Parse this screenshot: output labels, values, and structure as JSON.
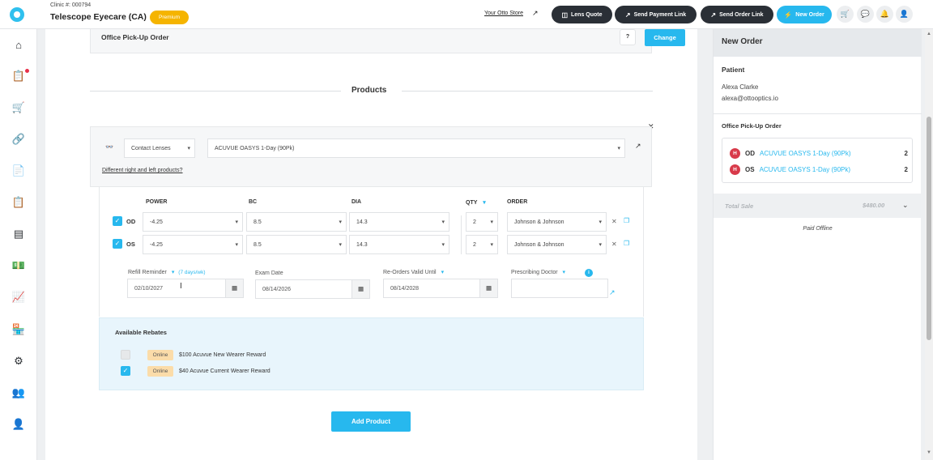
{
  "header": {
    "clinic_number": "Clinic #: 000794",
    "clinic_name": "Telescope Eyecare (CA)",
    "plan_badge": "Premium",
    "store_link": "Your Otto Store",
    "buttons": {
      "lens_quote": "Lens Quote",
      "send_payment_link": "Send Payment Link",
      "send_order_link": "Send Order Link",
      "new_order": "New Order"
    },
    "icons": [
      "cart-icon",
      "chat-icon",
      "bell-icon",
      "user-icon"
    ]
  },
  "sidebar": {
    "items": [
      "home-icon",
      "orders-icon",
      "cart-icon",
      "link-icon",
      "document-icon",
      "clipboard-icon",
      "inventory-icon",
      "money-icon",
      "analytics-icon",
      "store-icon",
      "settings-icon",
      "team-icon",
      "profile-icon"
    ],
    "notification": true
  },
  "pickup": {
    "title": "Office Pick-Up Order",
    "help": "?",
    "change_button": "Change"
  },
  "products": {
    "heading": "Products",
    "product_type": "Contact Lenses",
    "product_name": "ACUVUE OASYS 1-Day (90Pk)",
    "different_lr_link": "Different right and left products?",
    "columns": {
      "power": "POWER",
      "bc": "BC",
      "dia": "DIA",
      "qty": "QTY",
      "order": "ORDER"
    },
    "rows": [
      {
        "eye": "OD",
        "checked": true,
        "power": "-4.25",
        "bc": "8.5",
        "dia": "14.3",
        "qty": "2",
        "order": "Johnson & Johnson"
      },
      {
        "eye": "OS",
        "checked": true,
        "power": "-4.25",
        "bc": "8.5",
        "dia": "14.3",
        "qty": "2",
        "order": "Johnson & Johnson"
      }
    ],
    "refill_reminder_label": "Refill Reminder",
    "refill_reminder_hint": "(7 days/wk)",
    "refill_reminder_value": "02/10/2027",
    "exam_date_label": "Exam Date",
    "exam_date_value": "08/14/2026",
    "reorders_label": "Re-Orders Valid Until",
    "reorders_value": "08/14/2028",
    "prescribing_doctor_label": "Prescribing Doctor",
    "prescribing_doctor_value": ""
  },
  "rebates": {
    "title": "Available Rebates",
    "items": [
      {
        "checked": false,
        "tag": "Online",
        "label": "$100 Acuvue New Wearer Reward"
      },
      {
        "checked": true,
        "tag": "Online",
        "label": "$40 Acuvue Current Wearer Reward"
      }
    ]
  },
  "add_product_button": "Add Product",
  "right_panel": {
    "title": "New Order",
    "patient_heading": "Patient",
    "patient_name": "Alexa Clarke",
    "patient_email": "alexa@ottooptics.io",
    "pickup_heading": "Office Pick-Up Order",
    "items": [
      {
        "badge": "H",
        "eye": "OD",
        "product": "ACUVUE OASYS 1-Day (90Pk)",
        "qty": "2"
      },
      {
        "badge": "H",
        "eye": "OS",
        "product": "ACUVUE OASYS 1-Day (90Pk)",
        "qty": "2"
      }
    ],
    "total_label": "Total Sale",
    "total_value": "$480.00",
    "paid_status": "Paid Offline"
  },
  "colors": {
    "accent": "#27b8ee",
    "dark_button": "#2a2f36",
    "badge": "#f5b400",
    "notification": "#e8314a",
    "rebate_bg": "#e8f5fc"
  }
}
